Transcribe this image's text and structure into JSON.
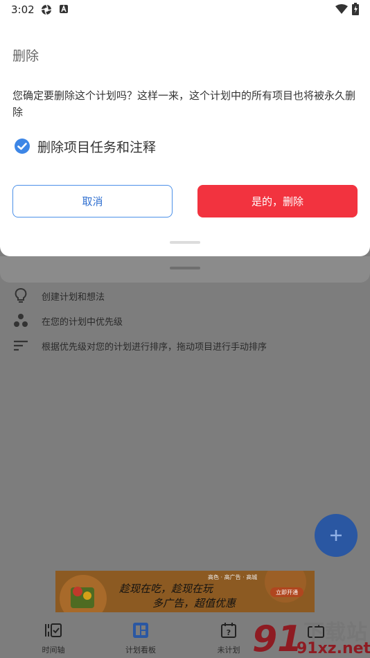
{
  "status_bar": {
    "time": "3:02"
  },
  "dialog": {
    "title": "删除",
    "message": "您确定要删除这个计划吗？这样一来，这个计划中的所有项目也将被永久删除",
    "checkbox_label": "删除项目任务和注释",
    "checkbox_checked": true,
    "cancel_label": "取消",
    "confirm_label": "是的，删除",
    "confirm_color": "#f2333f",
    "accent_color": "#4a8fe8"
  },
  "tips": [
    {
      "icon": "lightbulb-icon",
      "text": "创建计划和想法"
    },
    {
      "icon": "dots-icon",
      "text": "在您的计划中优先级"
    },
    {
      "icon": "sort-icon",
      "text": "根据优先级对您的计划进行排序，拖动项目进行手动排序"
    }
  ],
  "fab": {
    "icon": "plus-icon"
  },
  "ad": {
    "line1": "趁现在吃，趁现在玩",
    "line2": "多广告，超值优惠",
    "top_text": "高色 · 高广告 · 高城",
    "button": "立即开通"
  },
  "bottom_nav": [
    {
      "icon": "timeline-icon",
      "label": "时间轴"
    },
    {
      "icon": "board-icon",
      "label": "计划看板",
      "selected": true
    },
    {
      "icon": "unplanned-icon",
      "label": "未计划"
    },
    {
      "icon": "briefcase-icon",
      "label": ""
    }
  ],
  "watermark": {
    "big": "下载站",
    "small": "91xz.net",
    "number": "91"
  }
}
